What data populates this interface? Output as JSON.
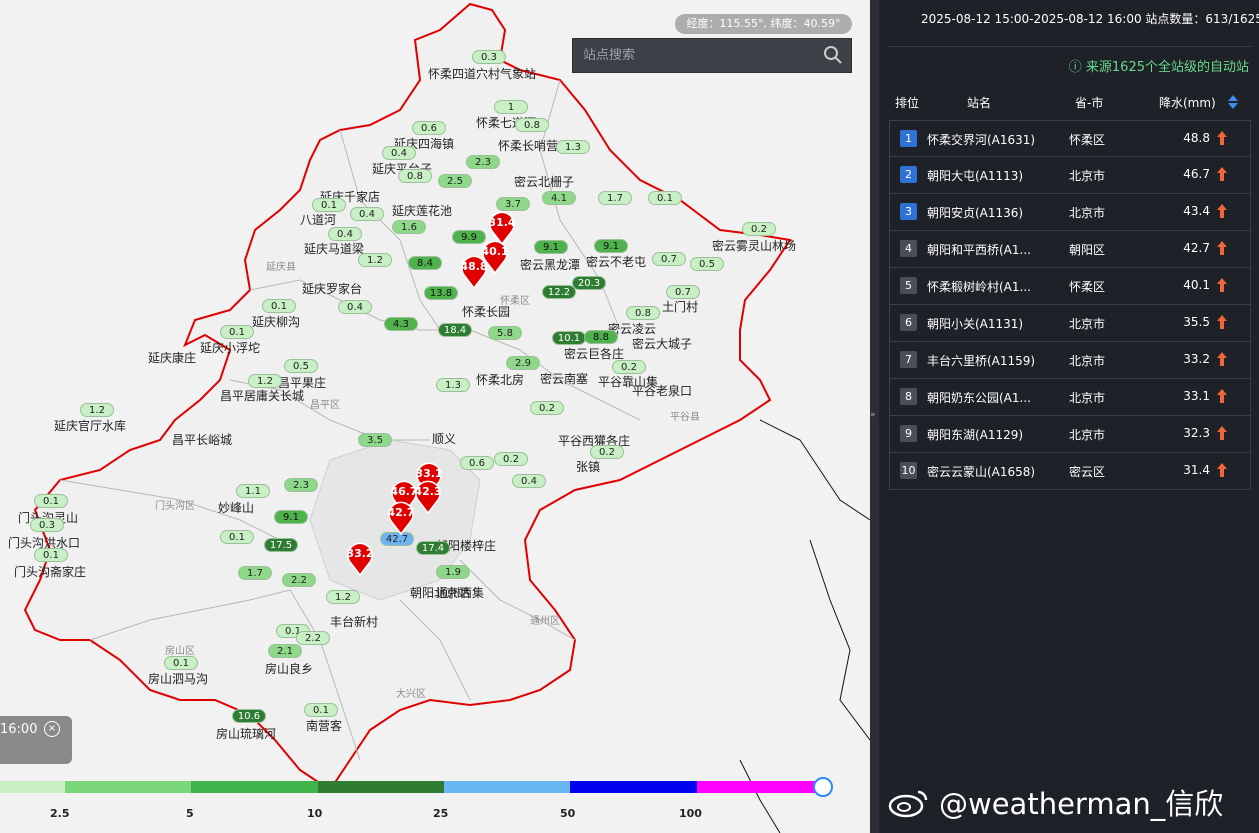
{
  "map": {
    "coord_readout": "经度：115.55°, 纬度：40.59°",
    "search_placeholder": "站点搜索",
    "time_label": "16:00",
    "districts": [
      "延庆县",
      "怀柔区",
      "昌平区",
      "平谷县",
      "门头沟区",
      "房山区",
      "大兴区",
      "通州区"
    ],
    "station_labels": [
      "怀柔四道穴村气象站",
      "怀柔七道河",
      "怀柔长哨营",
      "延庆四海镇",
      "延庆平台子",
      "延庆千家店",
      "密云北栅子",
      "延庆莲花池",
      "八道河",
      "延庆马道梁",
      "延庆罗家台",
      "延庆柳沟",
      "延庆小浮坨",
      "延庆康庄",
      "延庆官厅水库",
      "昌平长峪城",
      "昌平居庸关长城",
      "昌平果庄",
      "门头沟灵山",
      "门头沟洪水口",
      "门头沟斋家庄",
      "妙峰山",
      "房山泗马沟",
      "房山良乡",
      "房山琉璃河",
      "南营客",
      "丰台新村",
      "朝阳北京站",
      "朝阳楼梓庄",
      "通州西集",
      "张镇",
      "平谷西獾各庄",
      "密云巨各庄",
      "密云大城子",
      "密云凌云",
      "土门村",
      "密云雾灵山林场",
      "密云不老屯",
      "密云黑龙潭",
      "怀柔长园",
      "怀柔北房",
      "密云南塞",
      "平谷老泉口",
      "平谷靠山集",
      "顺义"
    ],
    "values": [
      "0.3",
      "1",
      "0.8",
      "0.6",
      "0.4",
      "0.8",
      "1.3",
      "2.3",
      "2.5",
      "0.1",
      "1.7",
      "0.1",
      "3.7",
      "4.1",
      "0.4",
      "0.4",
      "1.6",
      "9.9",
      "9.1",
      "9.1",
      "0.2",
      "0.7",
      "0.5",
      "1.2",
      "8.4",
      "20.3",
      "13.8",
      "12.2",
      "0.1",
      "0.4",
      "4.3",
      "18.4",
      "5.8",
      "10.1",
      "8.8",
      "0.8",
      "0.7",
      "0.1",
      "0.5",
      "1.3",
      "2.9",
      "0.2",
      "1.2",
      "1.2",
      "0.2",
      "3.5",
      "0.6",
      "2.3",
      "0.4",
      "0.1",
      "0.3",
      "0.1",
      "0.2",
      "1.1",
      "0.1",
      "9.1",
      "17.5",
      "1.7",
      "2.2",
      "0.1",
      "2.1",
      "0.1",
      "10.6",
      "0.1",
      "17.4",
      "42.7",
      "1.9",
      "1.2",
      "2.2",
      "0.2"
    ],
    "markers": [
      "31.4",
      "40.1",
      "48.8",
      "33.1",
      "46.7",
      "42.3",
      "42.7",
      "33.2"
    ],
    "legend_labels": [
      "2.5",
      "5",
      "10",
      "25",
      "50",
      "100"
    ],
    "legend_colors": [
      "#c8f0c3",
      "#7bd67a",
      "#3fb34a",
      "#2e7d32",
      "#6ab8f2",
      "#0000f0",
      "#ff00ff"
    ]
  },
  "panel": {
    "header": "2025-08-12 15:00-2025-08-12 16:00  站点数量：613/1625",
    "source": "来源1625个全站级的自动站",
    "columns": {
      "rank": "排位",
      "station": "站名",
      "province": "省-市",
      "rain": "降水(mm)"
    },
    "rows": [
      {
        "rank": "1",
        "name": "怀柔交界河(A1631)",
        "province": "怀柔区",
        "value": "48.8"
      },
      {
        "rank": "2",
        "name": "朝阳大屯(A1113)",
        "province": "北京市",
        "value": "46.7"
      },
      {
        "rank": "3",
        "name": "朝阳安贞(A1136)",
        "province": "北京市",
        "value": "43.4"
      },
      {
        "rank": "4",
        "name": "朝阳和平西桥(A1...",
        "province": "朝阳区",
        "value": "42.7"
      },
      {
        "rank": "5",
        "name": "怀柔椴树岭村(A1...",
        "province": "怀柔区",
        "value": "40.1"
      },
      {
        "rank": "6",
        "name": "朝阳小关(A1131)",
        "province": "北京市",
        "value": "35.5"
      },
      {
        "rank": "7",
        "name": "丰台六里桥(A1159)",
        "province": "北京市",
        "value": "33.2"
      },
      {
        "rank": "8",
        "name": "朝阳奶东公园(A1...",
        "province": "北京市",
        "value": "33.1"
      },
      {
        "rank": "9",
        "name": "朝阳东湖(A1129)",
        "province": "北京市",
        "value": "32.3"
      },
      {
        "rank": "10",
        "name": "密云云蒙山(A1658)",
        "province": "密云区",
        "value": "31.4"
      }
    ]
  },
  "watermark": "@weatherman_信欣"
}
